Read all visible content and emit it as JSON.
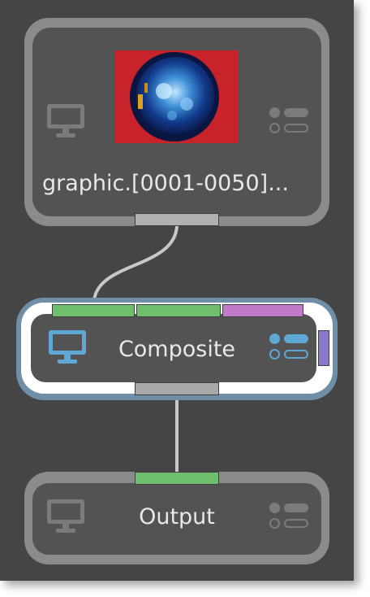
{
  "nodes": {
    "graphic": {
      "label": "graphic.[0001-0050]...",
      "thumbnail_bg": "#c8222a",
      "icon": "monitor-icon",
      "options_icon": "node-options-icon",
      "output_port_color": "#b0b0b0"
    },
    "composite": {
      "label": "Composite",
      "icon": "monitor-icon",
      "options_icon": "node-options-icon",
      "input_port_colors": [
        "#6fbf6f",
        "#6fbf6f",
        "#c07ac8"
      ],
      "side_port_color": "#8a78c8",
      "selected_outline_color": "#6f8ea8",
      "output_port_color": "#a8a8a8"
    },
    "output": {
      "label": "Output",
      "icon": "monitor-icon",
      "options_icon": "node-options-icon",
      "input_port_color": "#6fbf6f"
    }
  },
  "colors": {
    "canvas": "#454545",
    "node_frame": "#8b8b8b",
    "node_body": "#535353",
    "wire": "#c8c8c8",
    "active_icon": "#5fa7d4"
  }
}
